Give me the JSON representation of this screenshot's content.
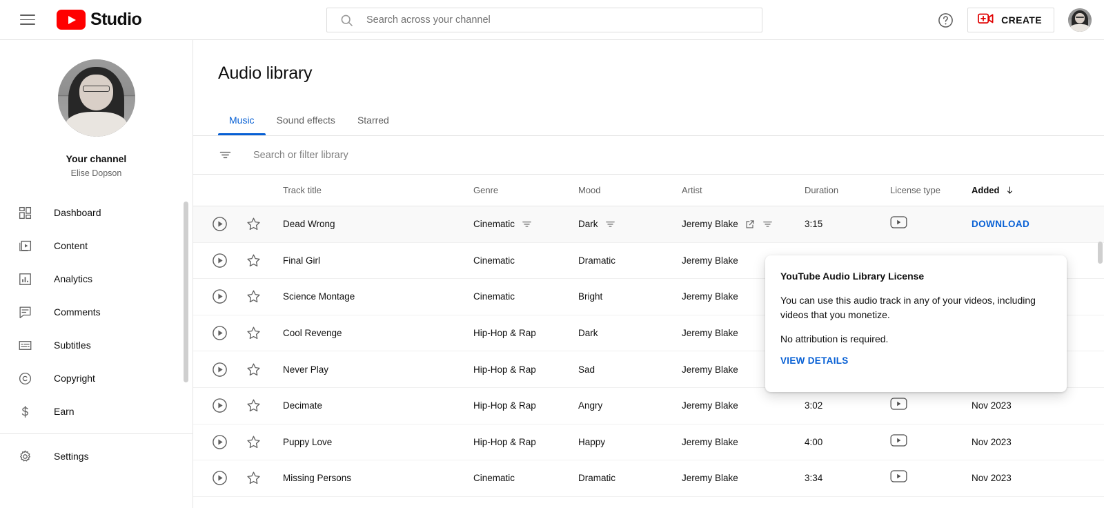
{
  "header": {
    "menu_icon": "hamburger-menu-icon",
    "logo_text": "Studio",
    "logo_icon": "youtube-logo-icon",
    "search": {
      "placeholder": "Search across your channel",
      "value": "",
      "icon": "search-icon"
    },
    "help_icon": "help-circle-icon",
    "create_label": "CREATE",
    "create_icon": "video-plus-icon",
    "avatar": "user-avatar"
  },
  "sidebar": {
    "channel_label": "Your channel",
    "channel_name": "Elise Dopson",
    "avatar": "channel-avatar",
    "items": [
      {
        "label": "Dashboard",
        "icon": "dashboard-icon"
      },
      {
        "label": "Content",
        "icon": "content-video-icon"
      },
      {
        "label": "Analytics",
        "icon": "analytics-bar-icon"
      },
      {
        "label": "Comments",
        "icon": "comments-icon"
      },
      {
        "label": "Subtitles",
        "icon": "subtitles-icon"
      },
      {
        "label": "Copyright",
        "icon": "copyright-icon"
      },
      {
        "label": "Earn",
        "icon": "dollar-icon"
      }
    ],
    "footer_items": [
      {
        "label": "Settings",
        "icon": "gear-icon"
      }
    ]
  },
  "main": {
    "page_title": "Audio library",
    "tabs": [
      {
        "label": "Music",
        "active": true
      },
      {
        "label": "Sound effects",
        "active": false
      },
      {
        "label": "Starred",
        "active": false
      }
    ],
    "filter": {
      "placeholder": "Search or filter library",
      "value": "",
      "icon": "filter-list-icon"
    },
    "columns": {
      "track_title": "Track title",
      "genre": "Genre",
      "mood": "Mood",
      "artist": "Artist",
      "duration": "Duration",
      "license_type": "License type",
      "added": "Added",
      "sort_icon": "arrow-down-icon",
      "sorted_by": "Added"
    },
    "rows": [
      {
        "title": "Dead Wrong",
        "genre": "Cinematic",
        "mood": "Dark",
        "artist": "Jeremy Blake",
        "duration": "3:15",
        "license_icon": "youtube-license-badge-icon",
        "added": "",
        "action": "DOWNLOAD",
        "hovered": true
      },
      {
        "title": "Final Girl",
        "genre": "Cinematic",
        "mood": "Dramatic",
        "artist": "Jeremy Blake",
        "duration": "",
        "license_icon": "",
        "added": "",
        "action": "",
        "hovered": false
      },
      {
        "title": "Science Montage",
        "genre": "Cinematic",
        "mood": "Bright",
        "artist": "Jeremy Blake",
        "duration": "",
        "license_icon": "",
        "added": "",
        "action": "",
        "hovered": false
      },
      {
        "title": "Cool Revenge",
        "genre": "Hip-Hop & Rap",
        "mood": "Dark",
        "artist": "Jeremy Blake",
        "duration": "",
        "license_icon": "",
        "added": "",
        "action": "",
        "hovered": false
      },
      {
        "title": "Never Play",
        "genre": "Hip-Hop & Rap",
        "mood": "Sad",
        "artist": "Jeremy Blake",
        "duration": "",
        "license_icon": "",
        "added": "",
        "action": "",
        "hovered": false
      },
      {
        "title": "Decimate",
        "genre": "Hip-Hop & Rap",
        "mood": "Angry",
        "artist": "Jeremy Blake",
        "duration": "3:02",
        "license_icon": "youtube-license-badge-icon",
        "added": "Nov 2023",
        "action": "",
        "hovered": false
      },
      {
        "title": "Puppy Love",
        "genre": "Hip-Hop & Rap",
        "mood": "Happy",
        "artist": "Jeremy Blake",
        "duration": "4:00",
        "license_icon": "youtube-license-badge-icon",
        "added": "Nov 2023",
        "action": "",
        "hovered": false
      },
      {
        "title": "Missing Persons",
        "genre": "Cinematic",
        "mood": "Dramatic",
        "artist": "Jeremy Blake",
        "duration": "3:34",
        "license_icon": "youtube-license-badge-icon",
        "added": "Nov 2023",
        "action": "",
        "hovered": false
      }
    ],
    "row_icons": {
      "play": "play-circle-icon",
      "star": "star-outline-icon",
      "filter": "filter-list-icon",
      "external_link": "open-in-new-icon"
    }
  },
  "license_popup": {
    "title": "YouTube Audio Library License",
    "body1": "You can use this audio track in any of your videos, including videos that you monetize.",
    "body2": "No attribution is required.",
    "link": "VIEW DETAILS"
  },
  "colors": {
    "accent_blue": "#065fd4",
    "youtube_red": "#ff0000",
    "text_primary": "#0f0f0f",
    "text_secondary": "#606060",
    "border": "#e5e5e5",
    "row_hover": "#f9f9f9"
  }
}
